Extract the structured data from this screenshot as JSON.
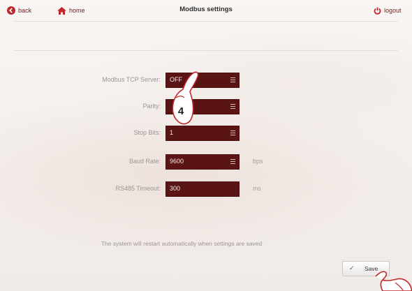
{
  "header": {
    "back_label": "back",
    "home_label": "home",
    "title": "Modbus settings",
    "logout_label": "logout"
  },
  "form": {
    "modbus_tcp_server": {
      "label": "Modbus TCP Server:",
      "value": "OFF"
    },
    "parity": {
      "label": "Parity:",
      "value": ""
    },
    "stop_bits": {
      "label": "Stop Bits:",
      "value": "1"
    },
    "baud_rate": {
      "label": "Baud Rate:",
      "value": "9600",
      "unit": "bps"
    },
    "rs485_timeout": {
      "label": "RS485 Timeout:",
      "value": "300",
      "unit": "ms"
    }
  },
  "notice": "The system will restart automatically when settings are saved",
  "save_button": {
    "label": "Save"
  },
  "annotation": {
    "step_number": "4"
  },
  "colors": {
    "accent": "#c0272d",
    "field_bg": "#5a1414",
    "background": "#f6f2ef"
  },
  "icons": [
    "back-icon",
    "home-icon",
    "power-icon",
    "menu-icon",
    "check-icon",
    "hand-pointer-icon"
  ]
}
